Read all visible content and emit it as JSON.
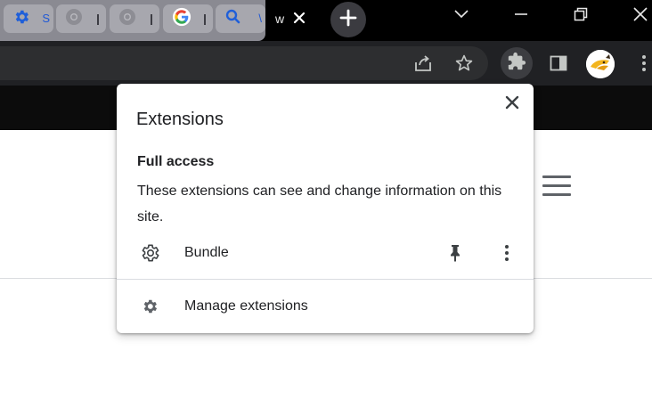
{
  "tabs": [
    {
      "icon": "settings-gear-icon",
      "label": "S"
    },
    {
      "icon": "chrome-favicon-icon",
      "label": ""
    },
    {
      "icon": "chrome-favicon-icon",
      "label": ""
    },
    {
      "icon": "google-g-icon",
      "label": ""
    },
    {
      "icon": "search-magnifier-icon",
      "label": "\\"
    }
  ],
  "active_tab": {
    "label": "w"
  },
  "popup": {
    "title": "Extensions",
    "section_title": "Full access",
    "section_description": "These extensions can see and change information on this site.",
    "extensions": [
      {
        "name": "Bundle",
        "icon": "gear-icon"
      }
    ],
    "manage_label": "Manage extensions"
  },
  "colors": {
    "tab_group": "#8a8a92",
    "toolbar": "#202124",
    "accent_blue": "#1a73e8",
    "text": "#202124"
  }
}
